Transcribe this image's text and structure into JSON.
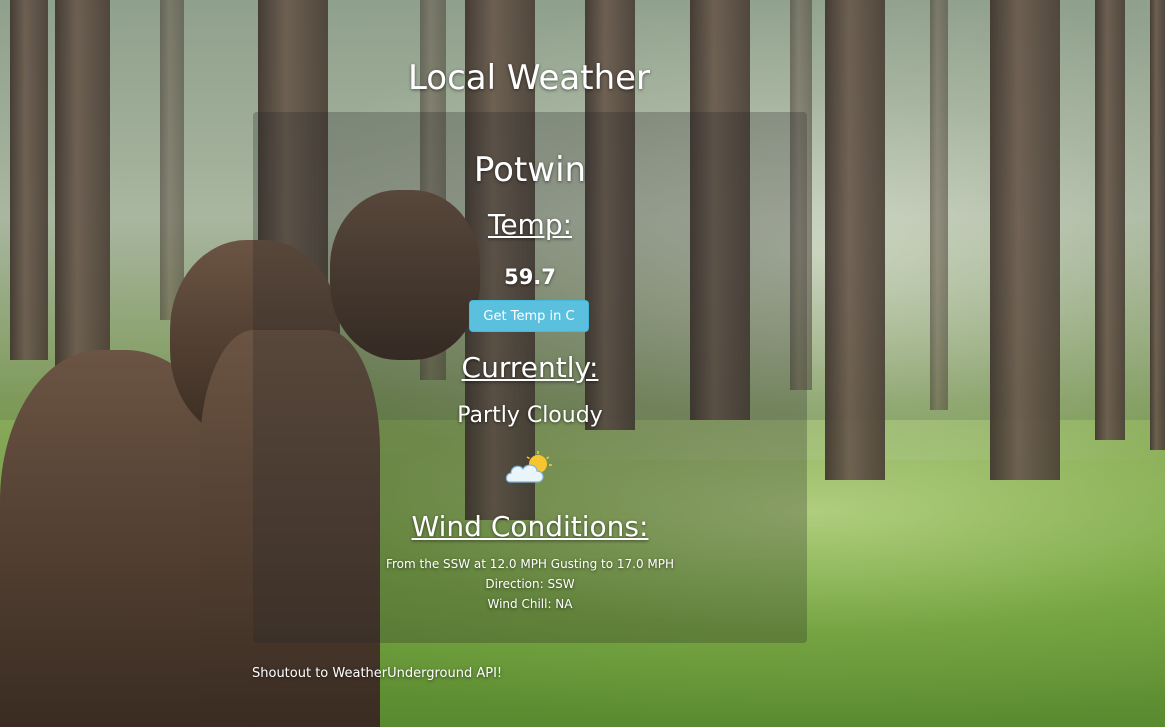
{
  "header": {
    "title": "Local Weather"
  },
  "weather": {
    "city": "Potwin",
    "temp_heading": "Temp:",
    "temp_value": "59.7",
    "convert_button_label": "Get Temp in C",
    "currently_heading": "Currently:",
    "condition": "Partly Cloudy",
    "condition_icon": "partly-cloudy-icon",
    "wind_heading": "Wind Conditions:",
    "wind_summary": "From the SSW at 12.0 MPH Gusting to 17.0 MPH",
    "wind_direction": "Direction: SSW",
    "wind_chill": "Wind Chill: NA"
  },
  "footer": {
    "credit": "Shoutout to WeatherUnderground API!"
  },
  "colors": {
    "button": "#5bc0de",
    "panel_overlay": "rgba(40,40,40,0.28)",
    "text": "#ffffff"
  }
}
